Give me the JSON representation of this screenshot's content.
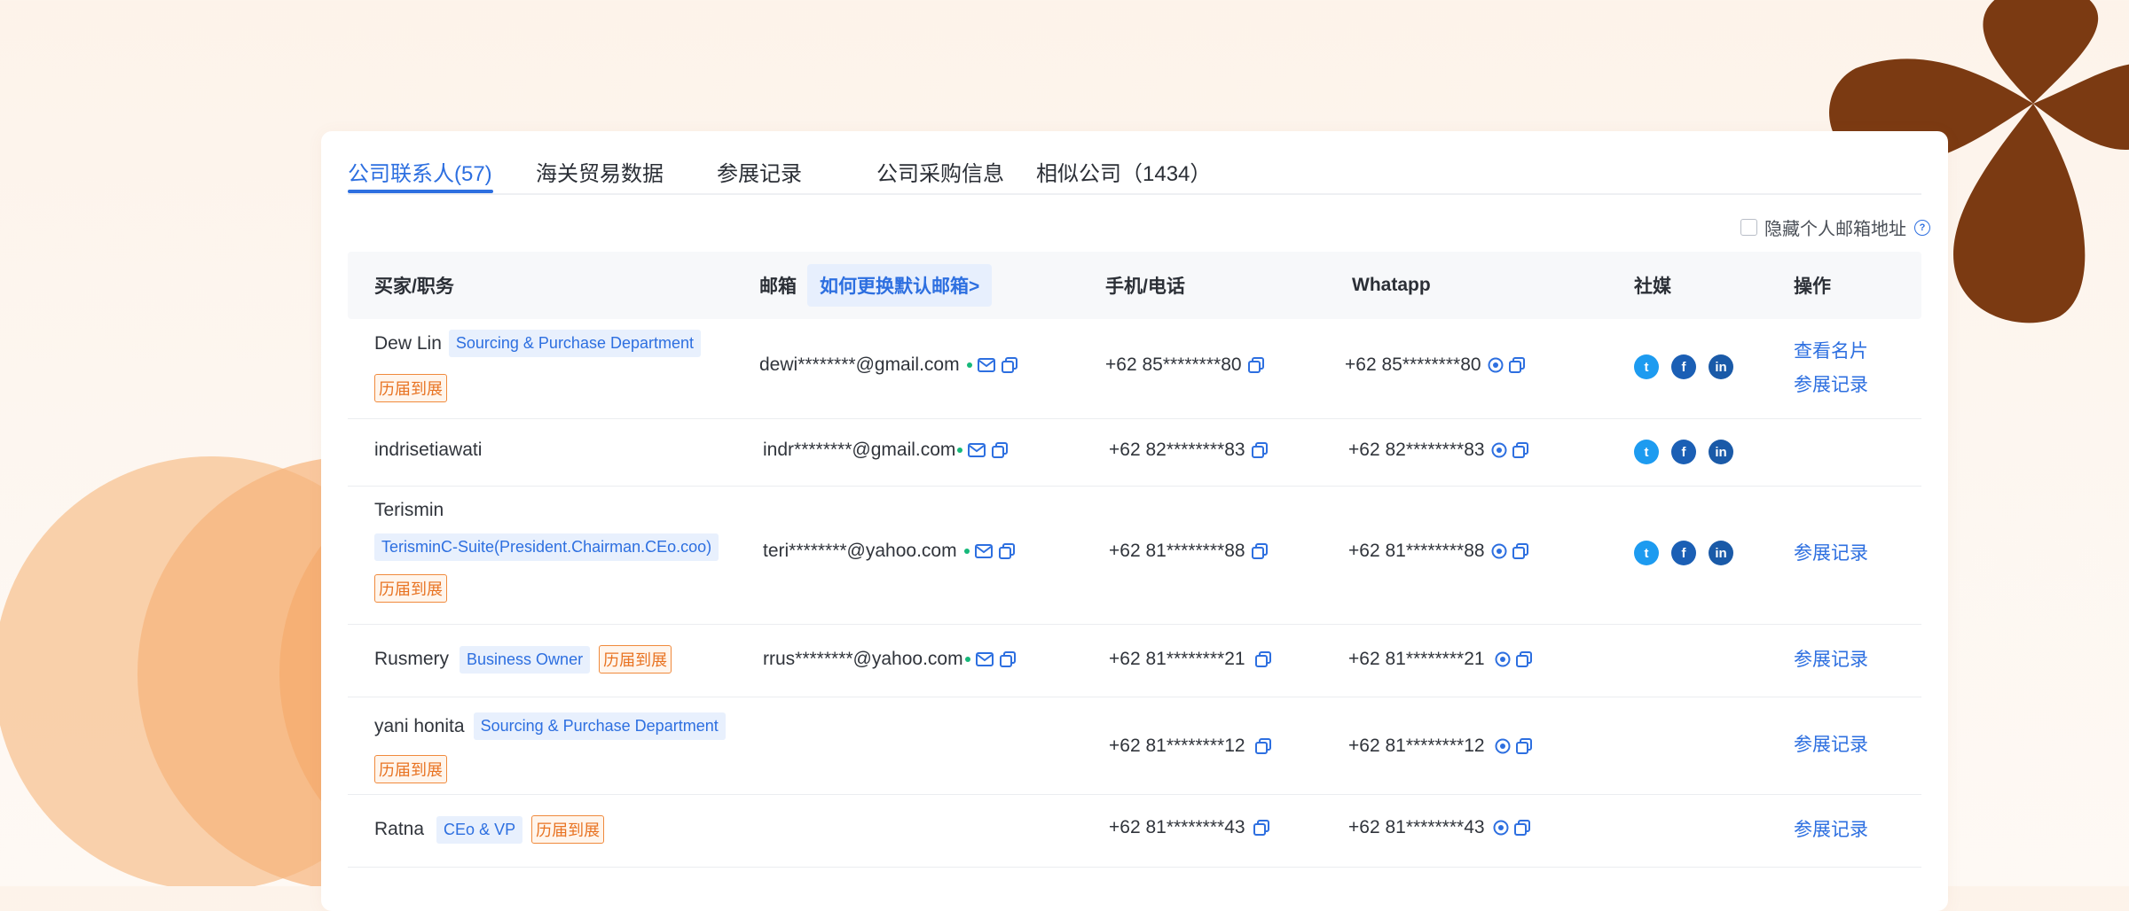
{
  "tabs": [
    {
      "label": "公司联系人(57)",
      "active": true
    },
    {
      "label": "海关贸易数据"
    },
    {
      "label": "参展记录"
    },
    {
      "label": "公司采购信息"
    },
    {
      "label": "相似公司（1434）"
    }
  ],
  "hide_personal_email_label": "隐藏个人邮箱地址",
  "table": {
    "headers": {
      "buyer": "买家/职务",
      "email": "邮箱",
      "email_help": "如何更换默认邮箱>",
      "phone": "手机/电话",
      "whatsapp": "Whatapp",
      "social": "社媒",
      "action": "操作"
    },
    "rows": [
      {
        "name": "Dew Lin",
        "role": "Sourcing & Purchase Department",
        "badge": "历届到展",
        "email": "dewi********@gmail.com",
        "phone": "+62 85********80",
        "whatsapp": "+62 85********80",
        "social": true,
        "actions": [
          "查看名片",
          "参展记录"
        ]
      },
      {
        "name": "indrisetiawati",
        "role": "",
        "badge": "",
        "email": "indr********@gmail.com",
        "phone": "+62 82********83",
        "whatsapp": "+62 82********83",
        "social": true,
        "actions": []
      },
      {
        "name": "Terismin",
        "role": "TerisminC-Suite(President.Chairman.CEo.coo)",
        "badge": "历届到展",
        "email": "teri********@yahoo.com",
        "phone": "+62 81********88",
        "whatsapp": "+62 81********88",
        "social": true,
        "actions": [
          "参展记录"
        ]
      },
      {
        "name": "Rusmery",
        "role": "Business Owner",
        "badge": "历届到展",
        "email": "rrus********@yahoo.com",
        "phone": "+62 81********21",
        "whatsapp": "+62 81********21",
        "social": false,
        "actions": [
          "参展记录"
        ]
      },
      {
        "name": "yani honita",
        "role": "Sourcing & Purchase Department",
        "badge": "历届到展",
        "email": "",
        "phone": "+62 81********12",
        "whatsapp": "+62 81********12",
        "social": false,
        "actions": [
          "参展记录"
        ]
      },
      {
        "name": "Ratna",
        "role": "CEo & VP",
        "badge": "历届到展",
        "email": "",
        "phone": "+62 81********43",
        "whatsapp": "+62 81********43",
        "social": false,
        "actions": [
          "参展记录"
        ]
      }
    ]
  },
  "icons": {
    "mail": "mail-icon",
    "copy": "copy-icon",
    "whatsapp": "whatsapp-icon",
    "twitter": "twitter-icon",
    "facebook": "facebook-icon",
    "linkedin": "linkedin-icon",
    "help": "help-icon"
  },
  "colors": {
    "accent": "#2d6fe0",
    "tag_orange": "#e87322",
    "verified_dot": "#16b87a",
    "deco_brown": "#7b3a12",
    "deco_orange": "#f7b57c"
  }
}
